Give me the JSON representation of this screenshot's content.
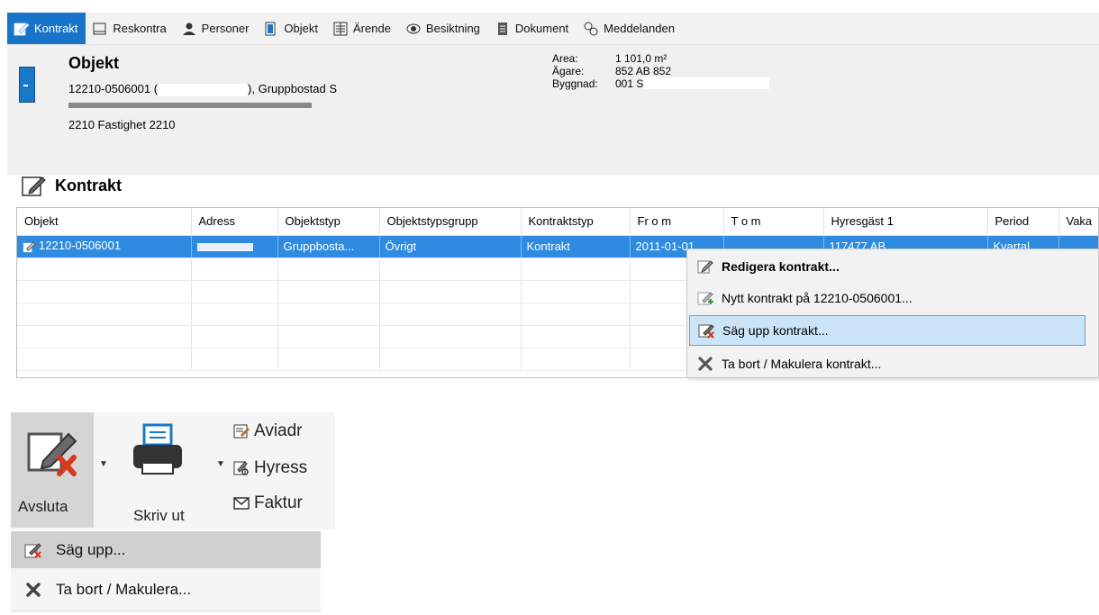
{
  "tabs": [
    {
      "label": "Kontrakt",
      "icon": "edit-contract-icon",
      "active": true
    },
    {
      "label": "Reskontra",
      "icon": "ledger-icon"
    },
    {
      "label": "Personer",
      "icon": "person-icon"
    },
    {
      "label": "Objekt",
      "icon": "object-icon"
    },
    {
      "label": "Ärende",
      "icon": "case-icon"
    },
    {
      "label": "Besiktning",
      "icon": "eye-icon"
    },
    {
      "label": "Dokument",
      "icon": "document-icon"
    },
    {
      "label": "Meddelanden",
      "icon": "messages-icon"
    }
  ],
  "object": {
    "title": "Objekt",
    "line1_prefix": "12210-0506001 (",
    "line1_suffix": "), Gruppbostad S",
    "line3": "2210 Fastighet 2210",
    "info": [
      {
        "label": "Area:",
        "value": "1 101,0 m²"
      },
      {
        "label": "Ägare:",
        "value": "852 AB 852"
      },
      {
        "label": "Byggnad:",
        "value": "001 S"
      }
    ]
  },
  "kontrakt_section": {
    "title": "Kontrakt"
  },
  "grid": {
    "columns": [
      "Objekt",
      "Adress",
      "Objektstyp",
      "Objektstypsgrupp",
      "Kontraktstyp",
      "Fr o m",
      "T o m",
      "Hyresgäst 1",
      "Period",
      "Vaka"
    ],
    "rows": [
      {
        "objekt": "12210-0506001",
        "adress": "",
        "objektstyp": "Gruppbosta...",
        "grupp": "Övrigt",
        "kontraktstyp": "Kontrakt",
        "from": "2011-01-01",
        "tom": "",
        "hyresgast": "117477 AB",
        "period": "Kvartal",
        "vaka": ""
      }
    ]
  },
  "context_menu": {
    "items": [
      {
        "label": "Redigera kontrakt...",
        "icon": "edit-contract-icon",
        "bold": true
      },
      {
        "label": "Nytt kontrakt på 12210-0506001...",
        "icon": "new-contract-icon"
      },
      {
        "label": "Säg upp kontrakt...",
        "icon": "terminate-contract-icon",
        "highlighted": true
      },
      {
        "label": "Ta bort / Makulera kontrakt...",
        "icon": "delete-x-icon"
      }
    ]
  },
  "ribbon": {
    "avsluta_label": "Avsluta",
    "skriv_label": "Skriv ut",
    "small_buttons": [
      {
        "label": "Aviadr",
        "icon": "notice-icon"
      },
      {
        "label": "Hyress",
        "icon": "tenant-search-icon"
      },
      {
        "label": "Faktur",
        "icon": "envelope-icon"
      }
    ]
  },
  "dropdown": {
    "items": [
      {
        "label": "Säg upp...",
        "icon": "terminate-contract-icon",
        "highlighted": true
      },
      {
        "label": "Ta bort / Makulera...",
        "icon": "delete-x-icon"
      }
    ]
  },
  "colors": {
    "accent": "#1874c8",
    "selection": "#2f8bdf",
    "menu_highlight": "#cce4f7"
  }
}
